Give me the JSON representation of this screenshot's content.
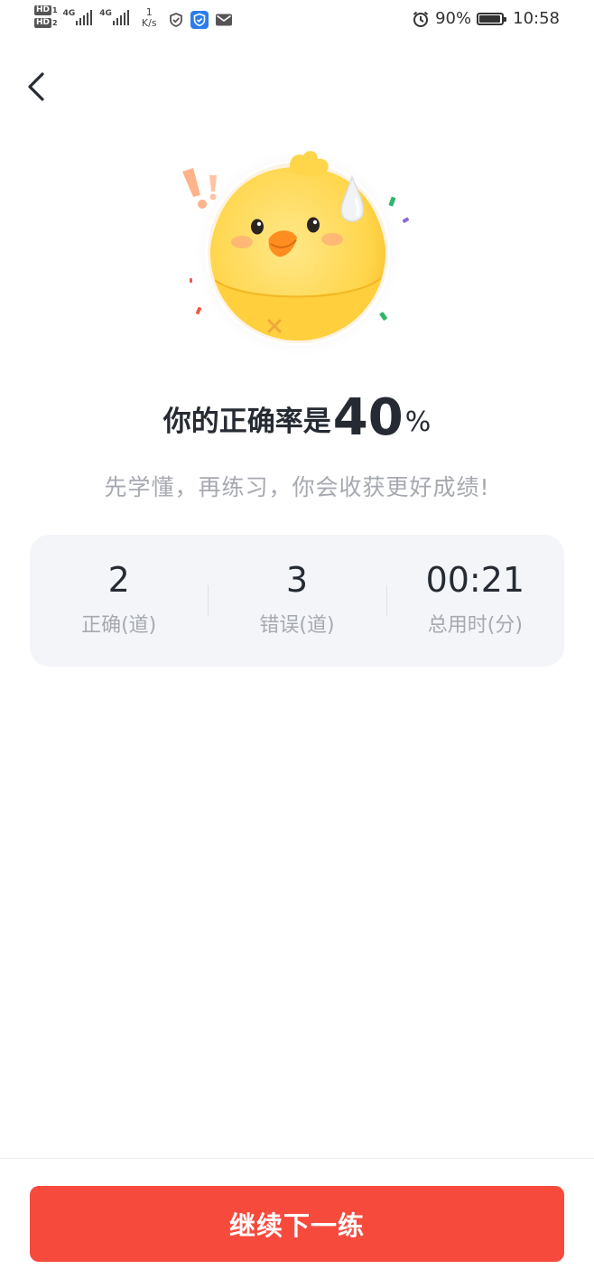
{
  "status_bar": {
    "sim1_badge": "HD",
    "sim1_num": "1",
    "sim2_badge": "HD",
    "sim2_num": "2",
    "net1_label": "4G",
    "net2_label": "4G",
    "speed_value": "1",
    "speed_unit": "K/s",
    "battery_percent": "90%",
    "time": "10:58"
  },
  "result": {
    "title_prefix": "你的正确率是",
    "rate_value": "40",
    "rate_unit": "%",
    "encourage_text": "先学懂，再练习，你会收获更好成绩!"
  },
  "stats": [
    {
      "value": "2",
      "label": "正确(道)"
    },
    {
      "value": "3",
      "label": "错误(道)"
    },
    {
      "value": "00:21",
      "label": "总用时(分)"
    }
  ],
  "footer": {
    "continue_label": "继续下一练"
  },
  "colors": {
    "accent": "#f64a3d",
    "text_primary": "#262b33",
    "text_secondary": "#a6a9b0",
    "card_bg": "#f3f5f9"
  },
  "icons": {
    "back": "chevron-left-icon",
    "alarm": "alarm-icon",
    "shield": "shield-icon",
    "mail": "mail-icon"
  }
}
